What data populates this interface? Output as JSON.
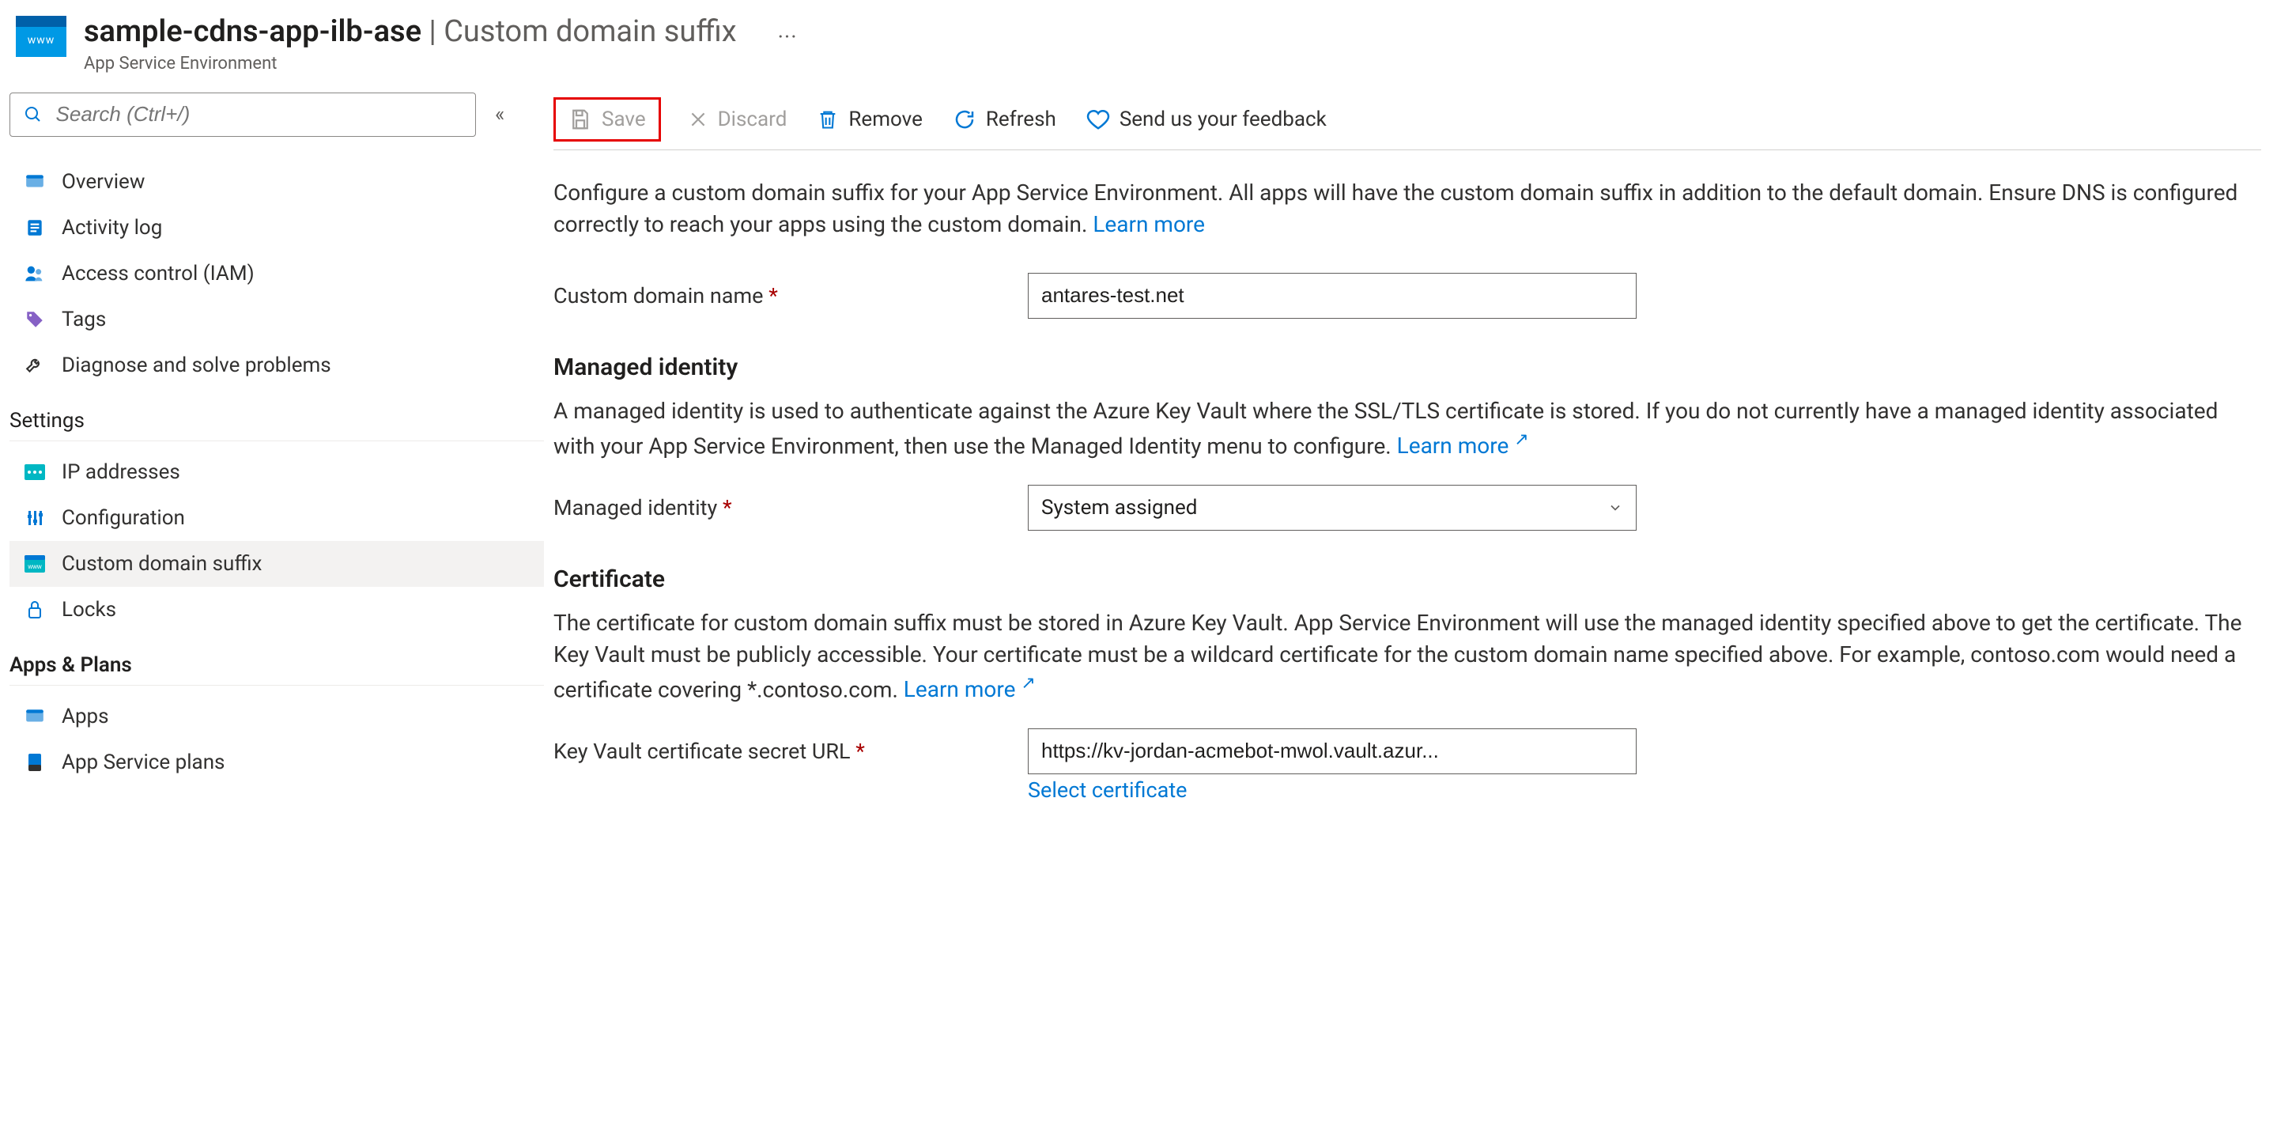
{
  "header": {
    "icon_label": "www",
    "resource_name": "sample-cdns-app-ilb-ase",
    "page_title": "Custom domain suffix",
    "subtitle": "App Service Environment",
    "separator": " | "
  },
  "sidebar": {
    "search_placeholder": "Search (Ctrl+/)",
    "items_top": [
      {
        "label": "Overview",
        "icon": "globe"
      },
      {
        "label": "Activity log",
        "icon": "log"
      },
      {
        "label": "Access control (IAM)",
        "icon": "people"
      },
      {
        "label": "Tags",
        "icon": "tag"
      },
      {
        "label": "Diagnose and solve problems",
        "icon": "wrench"
      }
    ],
    "section_settings": "Settings",
    "items_settings": [
      {
        "label": "IP addresses",
        "icon": "ip"
      },
      {
        "label": "Configuration",
        "icon": "config"
      },
      {
        "label": "Custom domain suffix",
        "icon": "domain",
        "selected": true
      },
      {
        "label": "Locks",
        "icon": "lock"
      }
    ],
    "section_apps": "Apps & Plans",
    "items_apps": [
      {
        "label": "Apps",
        "icon": "globe"
      },
      {
        "label": "App Service plans",
        "icon": "plan"
      }
    ]
  },
  "toolbar": {
    "save": "Save",
    "discard": "Discard",
    "remove": "Remove",
    "refresh": "Refresh",
    "feedback": "Send us your feedback"
  },
  "intro": {
    "text": "Configure a custom domain suffix for your App Service Environment. All apps will have the custom domain suffix in addition to the default domain. Ensure DNS is configured correctly to reach your apps using the custom domain. ",
    "learn_more": "Learn more"
  },
  "fields": {
    "custom_domain_label": "Custom domain name ",
    "custom_domain_value": "antares-test.net"
  },
  "managed_identity": {
    "title": "Managed identity",
    "text": "A managed identity is used to authenticate against the Azure Key Vault where the SSL/TLS certificate is stored. If you do not currently have a managed identity associated with your App Service Environment, then use the Managed Identity menu to configure. ",
    "learn_more": "Learn more",
    "field_label": "Managed identity ",
    "field_value": "System assigned"
  },
  "certificate": {
    "title": "Certificate",
    "text": "The certificate for custom domain suffix must be stored in Azure Key Vault. App Service Environment will use the managed identity specified above to get the certificate. The Key Vault must be publicly accessible. Your certificate must be a wildcard certificate for the custom domain name specified above. For example, contoso.com would need a certificate covering *.contoso.com. ",
    "learn_more": "Learn more",
    "field_label": "Key Vault certificate secret URL ",
    "field_value": "https://kv-jordan-acmebot-mwol.vault.azur...",
    "select_certificate": "Select certificate"
  }
}
